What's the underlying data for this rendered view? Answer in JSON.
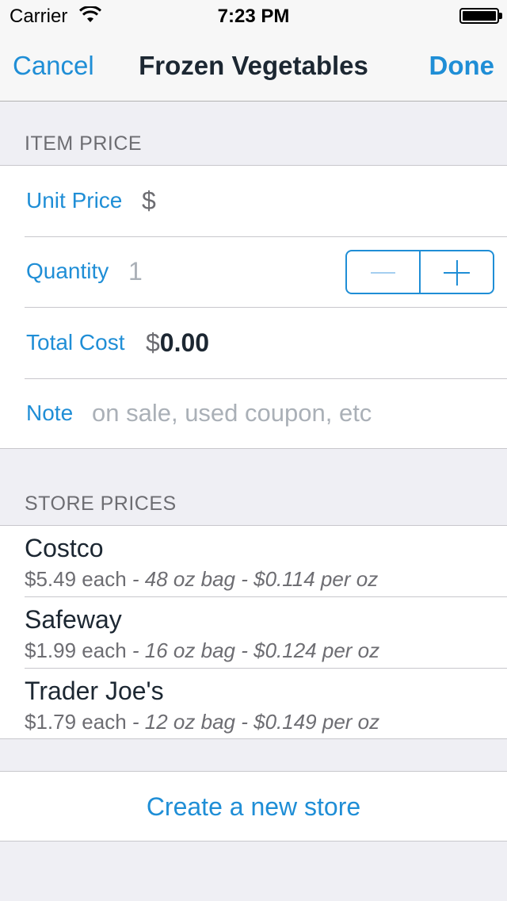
{
  "status_bar": {
    "carrier": "Carrier",
    "time": "7:23 PM",
    "wifi_icon": "wifi-icon",
    "battery_icon": "battery-icon"
  },
  "nav": {
    "cancel_label": "Cancel",
    "title": "Frozen Vegetables",
    "done_label": "Done"
  },
  "item_price": {
    "header": "ITEM PRICE",
    "unit_price_label": "Unit Price",
    "unit_price_value": "$",
    "quantity_label": "Quantity",
    "quantity_value": "1",
    "total_cost_label": "Total Cost",
    "total_cost_currency": "$",
    "total_cost_value": "0.00",
    "note_label": "Note",
    "note_placeholder": "on sale, used coupon, etc"
  },
  "store_prices": {
    "header": "STORE PRICES",
    "stores": [
      {
        "name": "Costco",
        "each": "$5.49 each",
        "sep1": " - ",
        "size": "48 oz bag",
        "sep2": " - ",
        "per": "$0.114 per oz"
      },
      {
        "name": "Safeway",
        "each": "$1.99 each",
        "sep1": " - ",
        "size": "16 oz bag",
        "sep2": " - ",
        "per": "$0.124 per oz"
      },
      {
        "name": "Trader Joe's",
        "each": "$1.79 each",
        "sep1": " - ",
        "size": "12 oz bag",
        "sep2": " - ",
        "per": "$0.149 per oz"
      }
    ]
  },
  "create_store_label": "Create a new store",
  "colors": {
    "accent": "#1f8ed6",
    "background": "#efeff4",
    "text_dark": "#1c2732",
    "secondary": "#6d6d72",
    "placeholder": "#aab0b7"
  }
}
